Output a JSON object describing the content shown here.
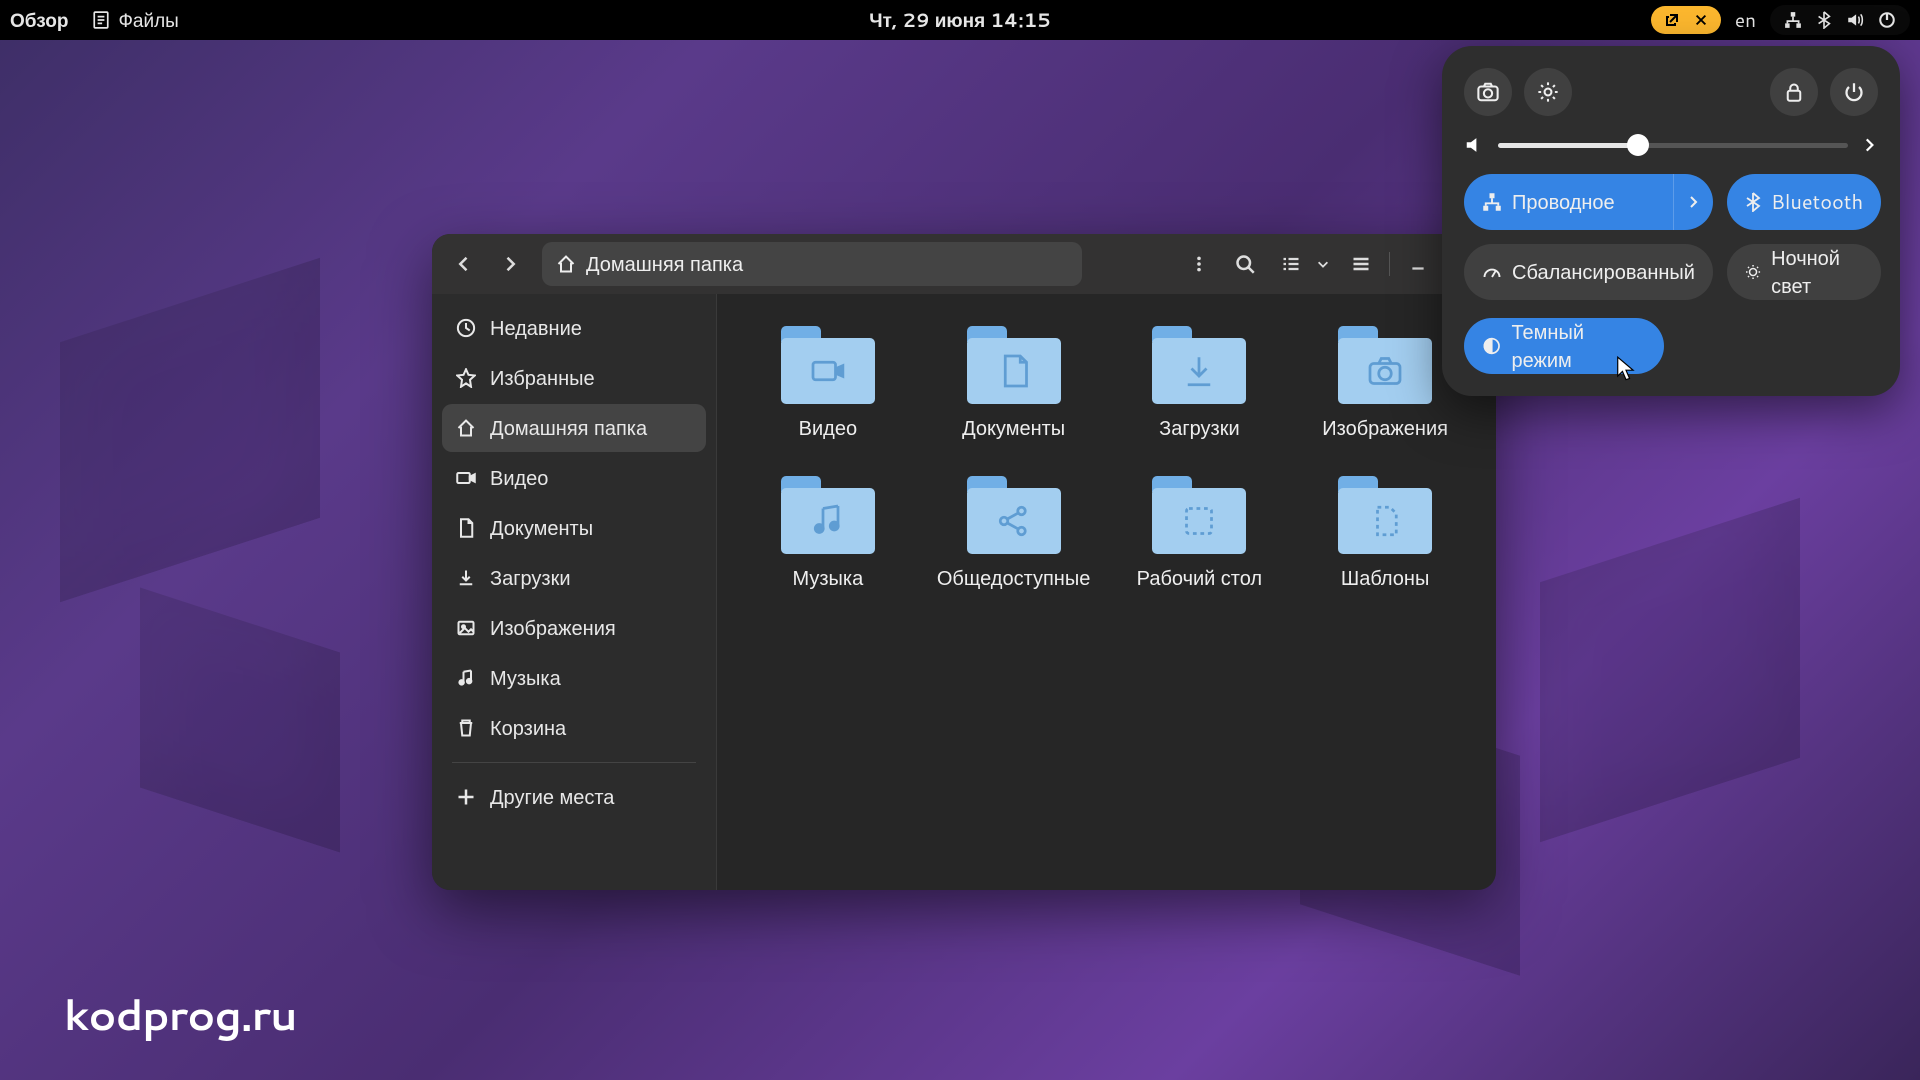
{
  "topbar": {
    "overview": "Обзор",
    "app": "Файлы",
    "datetime": "Чт, 29 июня  14:15",
    "lang": "en"
  },
  "fm": {
    "path": "Домашняя папка",
    "sidebar": [
      {
        "label": "Недавние",
        "icon": "clock"
      },
      {
        "label": "Избранные",
        "icon": "star"
      },
      {
        "label": "Домашняя папка",
        "icon": "home",
        "active": true
      },
      {
        "label": "Видео",
        "icon": "video"
      },
      {
        "label": "Документы",
        "icon": "doc"
      },
      {
        "label": "Загрузки",
        "icon": "download"
      },
      {
        "label": "Изображения",
        "icon": "image"
      },
      {
        "label": "Музыка",
        "icon": "music"
      },
      {
        "label": "Корзина",
        "icon": "trash"
      }
    ],
    "other_places": "Другие места",
    "folders": [
      {
        "label": "Видео",
        "glyph": "video"
      },
      {
        "label": "Документы",
        "glyph": "doc"
      },
      {
        "label": "Загрузки",
        "glyph": "download"
      },
      {
        "label": "Изображения",
        "glyph": "camera"
      },
      {
        "label": "Музыка",
        "glyph": "music"
      },
      {
        "label": "Общедоступные",
        "glyph": "share"
      },
      {
        "label": "Рабочий стол",
        "glyph": "desktop"
      },
      {
        "label": "Шаблоны",
        "glyph": "template"
      }
    ]
  },
  "qs": {
    "volume": 40,
    "toggles": {
      "wired": "Проводное",
      "bluetooth": "Bluetooth",
      "balanced": "Сбалансированный",
      "night": "Ночной свет",
      "dark": "Темный режим"
    }
  },
  "watermark": "kodprog.ru",
  "colors": {
    "accent": "#3584e4",
    "folder": "#a3cef0",
    "folderTab": "#71afe6"
  }
}
